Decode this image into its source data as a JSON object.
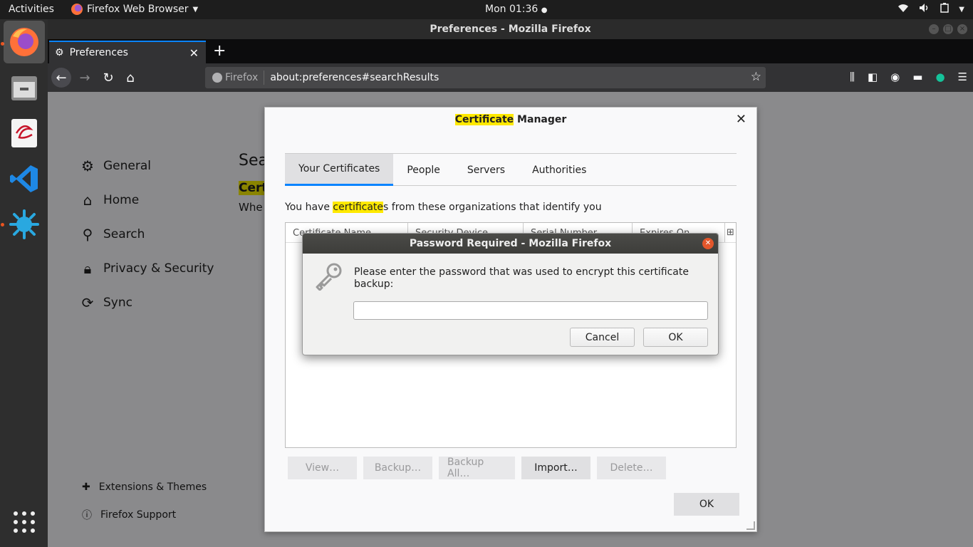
{
  "topbar": {
    "activities": "Activities",
    "app_name": "Firefox Web Browser",
    "clock": "Mon 01:36"
  },
  "window": {
    "title": "Preferences - Mozilla Firefox"
  },
  "browser": {
    "tab_label": "Preferences",
    "identity_label": "Firefox",
    "url": "about:preferences#searchResults"
  },
  "preferences": {
    "nav": [
      {
        "label": "General",
        "icon": "gear-icon"
      },
      {
        "label": "Home",
        "icon": "home-icon"
      },
      {
        "label": "Search",
        "icon": "search-icon"
      },
      {
        "label": "Privacy & Security",
        "icon": "lock-icon"
      },
      {
        "label": "Sync",
        "icon": "sync-icon"
      }
    ],
    "bottom": [
      {
        "label": "Extensions & Themes",
        "icon": "puzzle-icon"
      },
      {
        "label": "Firefox Support",
        "icon": "help-icon"
      }
    ],
    "heading_partial": "Sea",
    "section_partial": "Cert",
    "when_partial": "Whe"
  },
  "cert_manager": {
    "title_highlight": "Certificate",
    "title_rest": " Manager",
    "tabs": [
      "Your Certificates",
      "People",
      "Servers",
      "Authorities"
    ],
    "desc_before": "You have ",
    "desc_highlight": "certificate",
    "desc_after": "s from these organizations that identify you",
    "columns": [
      "Certificate Name",
      "Security Device",
      "Serial Number",
      "Expires On"
    ],
    "buttons": [
      "View…",
      "Backup…",
      "Backup All…",
      "Import…",
      "Delete…"
    ],
    "ok": "OK"
  },
  "password_dialog": {
    "title": "Password Required - Mozilla Firefox",
    "message": "Please enter the password that was used to encrypt this certificate backup:",
    "password_value": "",
    "cancel": "Cancel",
    "ok": "OK"
  },
  "colors": {
    "accent": "#0a84ff",
    "highlight": "#ffe900",
    "ubuntu_orange": "#e95420"
  }
}
